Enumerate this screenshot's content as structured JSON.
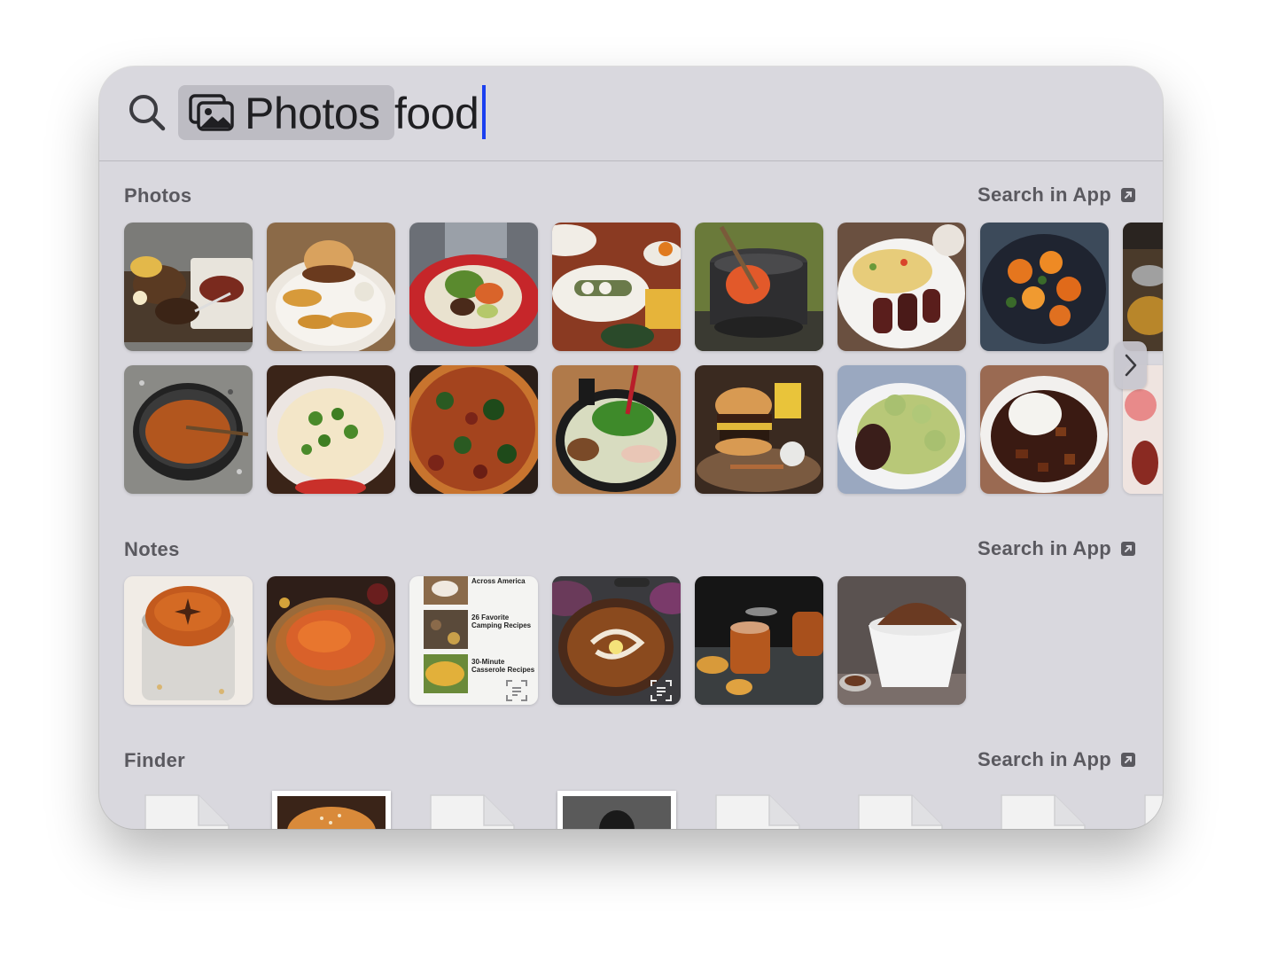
{
  "search": {
    "scope_label": "Photos",
    "query": "food"
  },
  "sections": {
    "photos": {
      "title": "Photos",
      "action": "Search in App"
    },
    "notes": {
      "title": "Notes",
      "action": "Search in App"
    },
    "finder": {
      "title": "Finder",
      "action": "Search in App"
    }
  },
  "notes_text": {
    "line1": "Across America",
    "line2a": "26 Favorite",
    "line2b": "Camping Recipes",
    "line3a": "30-Minute",
    "line3b": "Casserole Recipes"
  },
  "icons": {
    "search": "search-icon",
    "scope": "photos-app-icon",
    "open_in_app": "arrow-up-right-square-icon",
    "next": "chevron-right-icon",
    "live_text": "live-text-icon"
  }
}
